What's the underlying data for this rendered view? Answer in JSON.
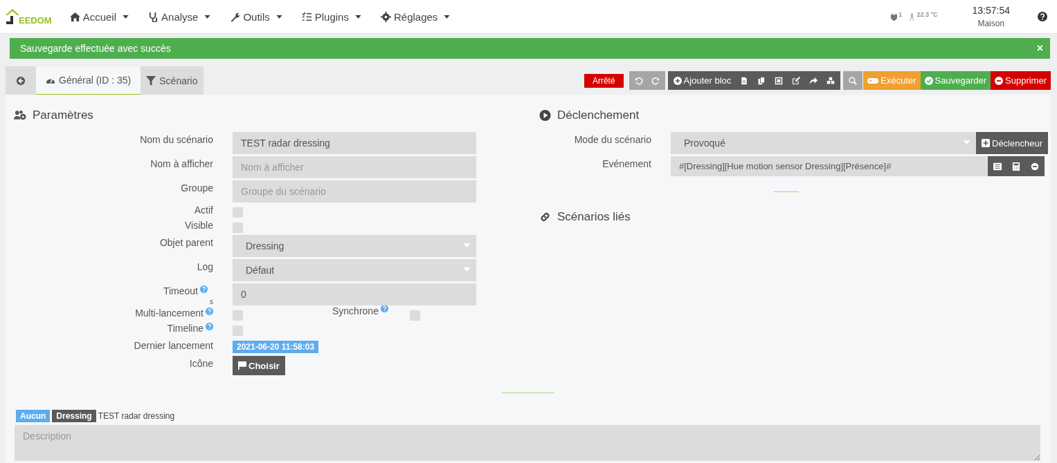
{
  "navbar": {
    "logo_text": "EEDOM",
    "menu": [
      {
        "label": "Accueil"
      },
      {
        "label": "Analyse"
      },
      {
        "label": "Outils"
      },
      {
        "label": "Plugins"
      },
      {
        "label": "Réglages"
      }
    ],
    "power_count": "1",
    "temperature": "22.3 °C",
    "time": "13:57:54",
    "place": "Maison"
  },
  "alert": {
    "message": "Sauvegarde effectuée avec succès",
    "close": "×"
  },
  "tabs": [
    {
      "label": "Général (ID : 35)",
      "selected": true
    },
    {
      "label": "Scénario",
      "selected": false
    }
  ],
  "toolbar": {
    "state": "Arrêté",
    "add_block": "Ajouter bloc",
    "execute": "Exécuter",
    "save": "Sauvegarder",
    "delete": "Supprimer"
  },
  "parameters": {
    "title": "Paramètres",
    "fields": [
      {
        "kind": "text",
        "label": "Nom du scénario",
        "value": "TEST radar dressing"
      },
      {
        "kind": "text",
        "label": "Nom à afficher",
        "placeholder": "Nom à afficher"
      },
      {
        "kind": "text",
        "label": "Groupe",
        "placeholder": "Groupe du scénario"
      },
      {
        "kind": "checkbox",
        "label": "Actif",
        "checked": false
      },
      {
        "kind": "checkbox",
        "label": "Visible",
        "checked": false
      },
      {
        "kind": "select",
        "label": "Objet parent",
        "value": "Dressing"
      },
      {
        "kind": "select",
        "label": "Log",
        "value": "Défaut"
      },
      {
        "kind": "timeout",
        "label": "Timeout",
        "unit": "s",
        "value": "0",
        "help": true
      },
      {
        "kind": "checkbox_pair",
        "label": "Multi-lancement",
        "checked": false,
        "help": true,
        "second_label": "Synchrone",
        "second_checked": false
      },
      {
        "kind": "checkbox",
        "label": "Timeline",
        "checked": false,
        "help": true
      },
      {
        "kind": "date",
        "label": "Dernier lancement",
        "value": "2021-06-20 11:58:03"
      },
      {
        "kind": "button",
        "label": "Icône",
        "value": "Choisir"
      }
    ]
  },
  "trigger": {
    "title": "Déclenchement",
    "mode_label": "Mode du scénario",
    "mode": "Provoqué",
    "trigger_button": "Déclencheur",
    "event_label": "Evénement",
    "event": "#[Dressing][Hue motion sensor Dressing][Présence]#"
  },
  "linked": {
    "title": "Scénarios liés"
  },
  "footer": {
    "tags": [
      {
        "label": "Aucun",
        "color": "#5cacee"
      },
      {
        "label": "Dressing",
        "color": "#5a5a5a"
      }
    ],
    "name": "TEST radar dressing",
    "description_placeholder": "Description"
  }
}
